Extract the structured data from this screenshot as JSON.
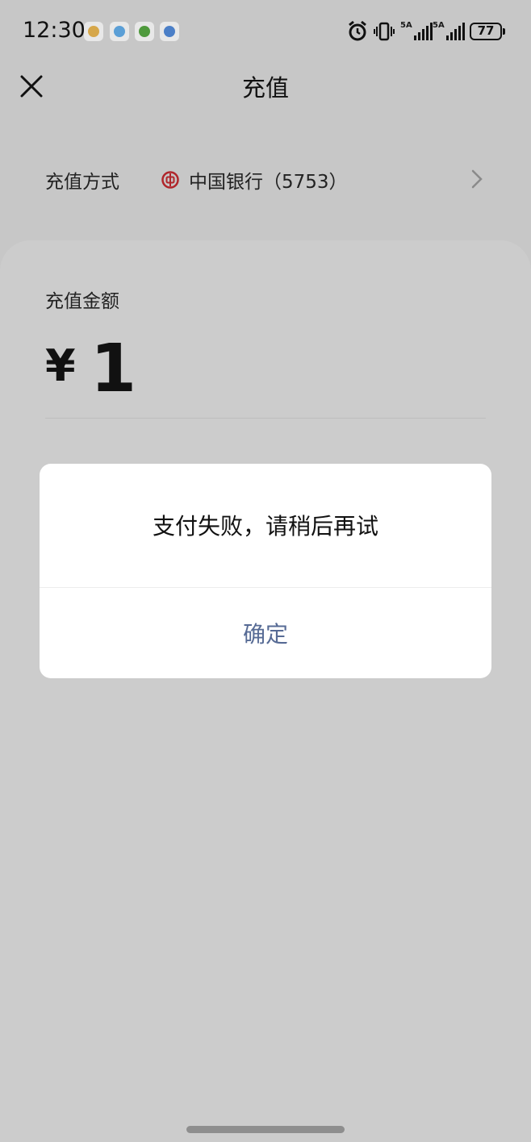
{
  "status_bar": {
    "time": "12:30",
    "notification_icons": [
      "app-icon-1",
      "app-icon-2",
      "app-icon-3",
      "app-icon-4"
    ],
    "system_icons": [
      "alarm-icon",
      "vibrate-icon",
      "signal-5g-icon",
      "signal-5g-icon"
    ],
    "network_label_1": "5A",
    "network_label_2": "5A",
    "battery": "77"
  },
  "nav": {
    "title": "充值",
    "close_icon": "close-icon"
  },
  "recharge_method": {
    "label": "充值方式",
    "bank_icon": "bank-of-china-icon",
    "bank_name": "中国银行（5753）",
    "chevron_icon": "chevron-right-icon"
  },
  "amount": {
    "label": "充值金额",
    "currency_symbol": "¥",
    "value": "1"
  },
  "dialog": {
    "message": "支付失败，请稍后再试",
    "confirm_label": "确定"
  },
  "colors": {
    "background": "#c7c7c7",
    "card": "#cccccc",
    "dialog_bg": "#ffffff",
    "dialog_button_text": "#576b95",
    "bank_logo_red": "#b0262b"
  }
}
